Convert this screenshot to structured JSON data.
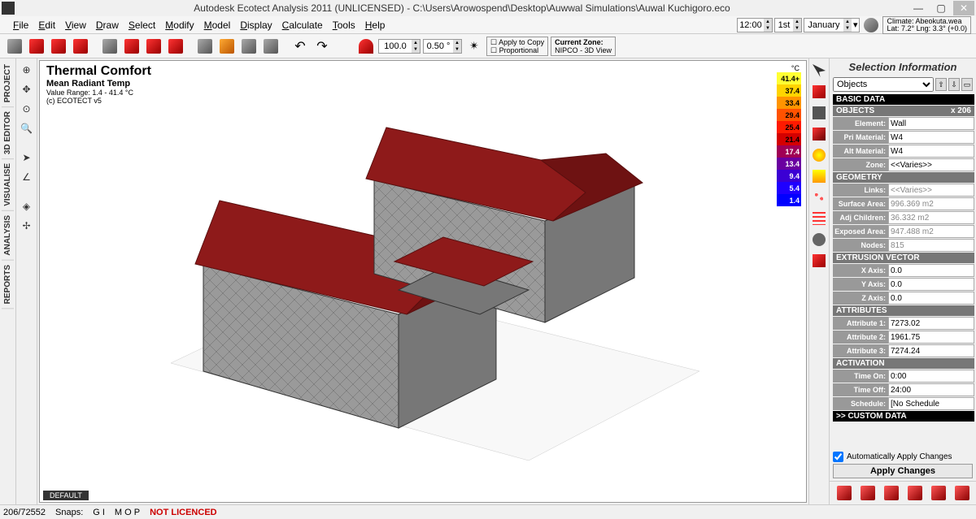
{
  "title": "Autodesk Ecotect Analysis 2011 (UNLICENSED) - C:\\Users\\Arowospend\\Desktop\\Auwwal Simulations\\Auwal Kuchigoro.eco",
  "menus": [
    "File",
    "Edit",
    "View",
    "Draw",
    "Select",
    "Modify",
    "Model",
    "Display",
    "Calculate",
    "Tools",
    "Help"
  ],
  "time": {
    "hour": "12:00",
    "period": "1st",
    "month": "January"
  },
  "climate": {
    "line1": "Climate: Abeokuta.wea",
    "line2": "Lat: 7.2°   Lng: 3.3° (+0.0)"
  },
  "distance": "100.0",
  "angle": "0.50 °",
  "copybox": {
    "line1": "Apply to Copy",
    "line2": "Proportional"
  },
  "zonebox": {
    "line1": "Current Zone:",
    "line2": "NIPCO - 3D View"
  },
  "left_vtabs": [
    "PROJECT",
    "3D EDITOR",
    "VISUALISE",
    "ANALYSIS",
    "REPORTS"
  ],
  "viewport": {
    "title": "Thermal Comfort",
    "subtitle": "Mean Radiant Temp",
    "range": "Value Range: 1.4 - 41.4 °C",
    "copyright": "(c) ECOTECT v5",
    "tab": "DEFAULT"
  },
  "legend": {
    "unit": "°C",
    "stops": [
      {
        "v": "41.4+",
        "c": "#ffff33"
      },
      {
        "v": "37.4",
        "c": "#ffd400"
      },
      {
        "v": "33.4",
        "c": "#ff9400"
      },
      {
        "v": "29.4",
        "c": "#ff5200"
      },
      {
        "v": "25.4",
        "c": "#ff1a00"
      },
      {
        "v": "21.4",
        "c": "#d40000"
      },
      {
        "v": "17.4",
        "c": "#a00055"
      },
      {
        "v": "13.4",
        "c": "#6a00a0"
      },
      {
        "v": "9.4",
        "c": "#3b00d4"
      },
      {
        "v": "5.4",
        "c": "#1f00ff"
      },
      {
        "v": "1.4",
        "c": "#0000ff"
      }
    ]
  },
  "right": {
    "title": "Selection Information",
    "dropdown": "Objects",
    "sections": {
      "basic": "BASIC DATA",
      "objects_hdr": "OBJECTS",
      "objects_count": "x 206",
      "geometry": "GEOMETRY",
      "extrusion": "EXTRUSION VECTOR",
      "attributes": "ATTRIBUTES",
      "activation": "ACTIVATION",
      "custom": ">> CUSTOM DATA"
    },
    "rows": {
      "element": {
        "l": "Element:",
        "v": "Wall"
      },
      "primat": {
        "l": "Pri Material:",
        "v": "W4"
      },
      "altmat": {
        "l": "Alt Material:",
        "v": "W4"
      },
      "zone": {
        "l": "Zone:",
        "v": "<<Varies>>"
      },
      "links": {
        "l": "Links:",
        "v": "<<Varies>>"
      },
      "surface": {
        "l": "Surface Area:",
        "v": "996.369 m2"
      },
      "adjch": {
        "l": "Adj Children:",
        "v": "36.332 m2"
      },
      "exposed": {
        "l": "Exposed Area:",
        "v": "947.488 m2"
      },
      "nodes": {
        "l": "Nodes:",
        "v": "815"
      },
      "xaxis": {
        "l": "X Axis:",
        "v": "0.0"
      },
      "yaxis": {
        "l": "Y Axis:",
        "v": "0.0"
      },
      "zaxis": {
        "l": "Z Axis:",
        "v": "0.0"
      },
      "attr1": {
        "l": "Attribute 1:",
        "v": "7273.02"
      },
      "attr2": {
        "l": "Attribute 2:",
        "v": "1961.75"
      },
      "attr3": {
        "l": "Attribute 3:",
        "v": "7274.24"
      },
      "timeon": {
        "l": "Time On:",
        "v": "0:00"
      },
      "timeoff": {
        "l": "Time Off:",
        "v": "24:00"
      },
      "schedule": {
        "l": "Schedule:",
        "v": "[No Schedule"
      }
    },
    "auto_apply": "Automatically Apply Changes",
    "apply": "Apply Changes"
  },
  "status": {
    "count": "206/72552",
    "snaps": "Snaps:",
    "gi": "G I",
    "mop": "M O P",
    "nl": "NOT LICENCED"
  }
}
